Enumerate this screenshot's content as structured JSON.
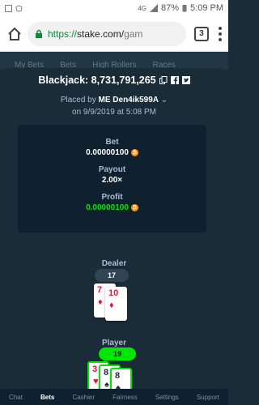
{
  "status_bar": {
    "battery": "87%",
    "time": "5:09 PM",
    "network": "4G"
  },
  "browser": {
    "url_prefix": "https://",
    "url_host": "stake.com/",
    "url_rest": "gam",
    "tab_count": "3"
  },
  "bg_tabs": [
    "My Bets",
    "Bets",
    "High Rollers",
    "Races"
  ],
  "modal": {
    "title": "Blackjack: 8,731,791,265",
    "placed_by_label": "Placed by",
    "user": "ME Den4ik599A",
    "placed_on": "on 9/9/2019 at 5:08 PM"
  },
  "stats": {
    "bet_label": "Bet",
    "bet_value": "0.00000100",
    "payout_label": "Payout",
    "payout_value": "2.00×",
    "profit_label": "Profit",
    "profit_value": "0.00000100",
    "coin_symbol": "₿"
  },
  "dealer": {
    "label": "Dealer",
    "total": "17",
    "cards": [
      {
        "rank": "7",
        "suit": "♦"
      },
      {
        "rank": "10",
        "suit": "♦"
      }
    ]
  },
  "player": {
    "label": "Player",
    "total": "19",
    "cards": [
      {
        "rank": "3",
        "suit": "♥"
      },
      {
        "rank": "8",
        "suit": "♠"
      },
      {
        "rank": "8",
        "suit": "♠"
      }
    ]
  },
  "nav": [
    "Chat",
    "Bets",
    "Cashier",
    "Fairness",
    "Settings",
    "Support"
  ],
  "colors": {
    "accent": "#00e701",
    "bg": "#1a2c38",
    "panel": "#0f212e"
  }
}
